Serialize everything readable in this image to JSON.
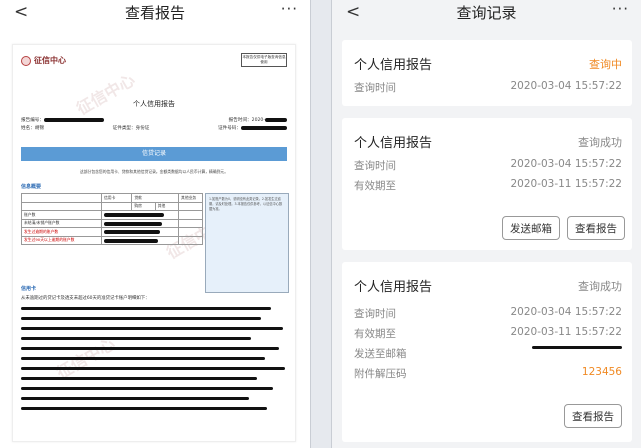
{
  "left": {
    "nav": {
      "back": "<",
      "title": "查看报告",
      "more": "···"
    },
    "report": {
      "logo_text": "征信中心",
      "stamp_text": "本报告仅供电子版查询信息使用",
      "title": "个人信用报告",
      "report_no_label": "报告编号：",
      "report_time_label": "报告时间：2020-",
      "name_label": "姓名：",
      "name_value": "胡锦",
      "id_type_label": "证件类型：身份证",
      "id_no_label": "证件号码：",
      "section": "信贷记录",
      "note": "这部分包含您的信用卡、贷款和其他信贷记录。金额类数据均以人民币计算，精确到元。",
      "summary_head": "信息概要",
      "table": {
        "col_card": "信用卡",
        "col_loan": "贷款",
        "col_other": "其他业务",
        "sub_house": "购房",
        "sub_other": "其他",
        "rows": [
          "账户数",
          "未结清/未销户账户数",
          "发生过逾期的账户数",
          "发生过90天以上逾期的账户数"
        ]
      },
      "side_note": "1.如账户数为0，说明没有此类记录。2.如发生过逾期，请及时处理。3.本报告仅供参考，以征信中心数据为准。",
      "card_head": "信用卡",
      "card_intro": "从未逾期过的贷记卡及透支未超过60天的准贷记卡账户明细如下：",
      "watermark": "征信中心"
    }
  },
  "right": {
    "nav": {
      "back": "<",
      "title": "查询记录",
      "more": "···"
    },
    "cards": [
      {
        "title": "个人信用报告",
        "status": "查询中",
        "rows": [
          {
            "label": "查询时间",
            "value": "2020-03-04 15:57:22"
          }
        ]
      },
      {
        "title": "个人信用报告",
        "status": "查询成功",
        "rows": [
          {
            "label": "查询时间",
            "value": "2020-03-04 15:57:22"
          },
          {
            "label": "有效期至",
            "value": "2020-03-11 15:57:22"
          }
        ],
        "btn_email": "发送邮箱",
        "btn_view": "查看报告"
      },
      {
        "title": "个人信用报告",
        "status": "查询成功",
        "rows": [
          {
            "label": "查询时间",
            "value": "2020-03-04 15:57:22"
          },
          {
            "label": "有效期至",
            "value": "2020-03-11 15:57:22"
          },
          {
            "label": "发送至邮箱",
            "value": ""
          },
          {
            "label": "附件解压码",
            "value": "123456"
          }
        ],
        "btn_view": "查看报告"
      }
    ]
  },
  "colors": {
    "accent_orange": "#f08a24",
    "band_blue": "#5b9bd5"
  }
}
